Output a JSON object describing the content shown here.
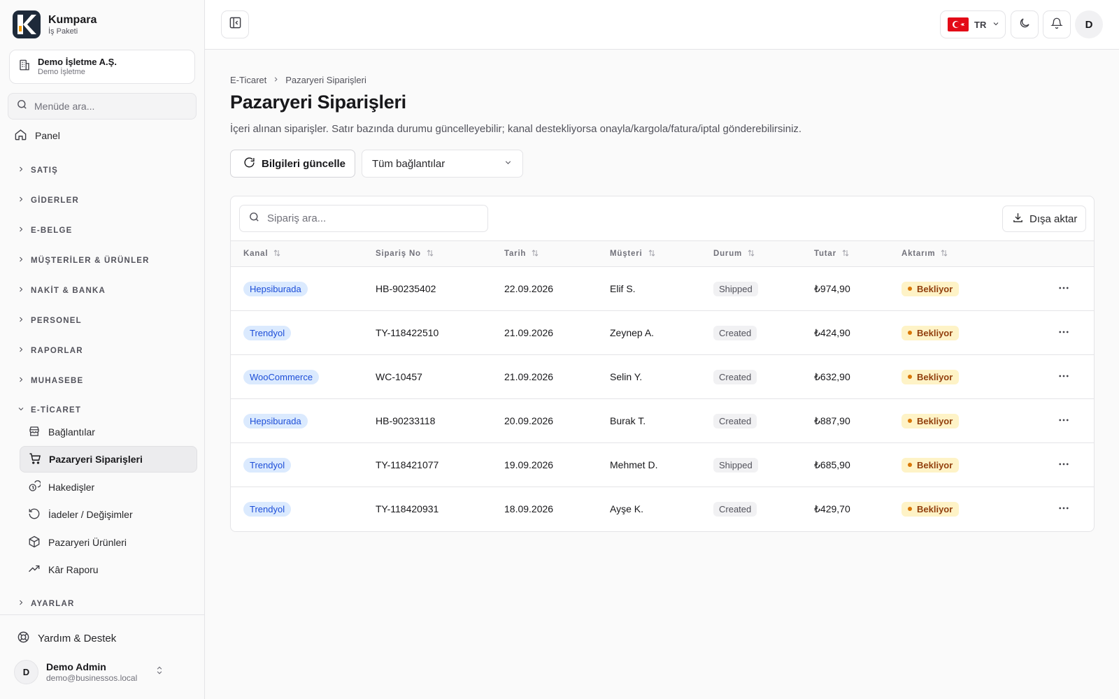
{
  "brand": {
    "name": "Kumpara",
    "sub": "İş Paketi"
  },
  "org": {
    "name": "Demo İşletme A.Ş.",
    "sub": "Demo İşletme"
  },
  "sidebar": {
    "search_placeholder": "Menüde ara...",
    "panel": "Panel",
    "sections": [
      "SATIŞ",
      "GİDERLER",
      "E-BELGE",
      "MÜŞTERİLER & ÜRÜNLER",
      "NAKİT & BANKA",
      "PERSONEL",
      "RAPORLAR",
      "MUHASEBE",
      "E-TİCARET",
      "AYARLAR"
    ],
    "ecommerce_items": [
      "Bağlantılar",
      "Pazaryeri Siparişleri",
      "Hakedişler",
      "İadeler / Değişimler",
      "Pazaryeri Ürünleri",
      "Kâr Raporu"
    ],
    "help": "Yardım & Destek",
    "user": {
      "initial": "D",
      "name": "Demo Admin",
      "email": "demo@businessos.local"
    }
  },
  "header": {
    "lang": "TR",
    "avatar_initial": "D"
  },
  "breadcrumb": [
    "E-Ticaret",
    "Pazaryeri Siparişleri"
  ],
  "page": {
    "title": "Pazaryeri Siparişleri",
    "description": "İçeri alınan siparişler. Satır bazında durumu güncelleyebilir; kanal destekliyorsa onayla/kargola/fatura/iptal gönderebilirsiniz.",
    "refresh_label": "Bilgileri güncelle",
    "connection_select": "Tüm bağlantılar"
  },
  "table": {
    "search_placeholder": "Sipariş ara...",
    "export_label": "Dışa aktar",
    "columns": [
      "Kanal",
      "Sipariş No",
      "Tarih",
      "Müşteri",
      "Durum",
      "Tutar",
      "Aktarım"
    ],
    "rows": [
      {
        "channel": "Hepsiburada",
        "order_no": "HB-90235402",
        "date": "22.09.2026",
        "customer": "Elif S.",
        "status": "Shipped",
        "amount": "₺974,90",
        "transfer": "Bekliyor"
      },
      {
        "channel": "Trendyol",
        "order_no": "TY-118422510",
        "date": "21.09.2026",
        "customer": "Zeynep A.",
        "status": "Created",
        "amount": "₺424,90",
        "transfer": "Bekliyor"
      },
      {
        "channel": "WooCommerce",
        "order_no": "WC-10457",
        "date": "21.09.2026",
        "customer": "Selin Y.",
        "status": "Created",
        "amount": "₺632,90",
        "transfer": "Bekliyor"
      },
      {
        "channel": "Hepsiburada",
        "order_no": "HB-90233118",
        "date": "20.09.2026",
        "customer": "Burak T.",
        "status": "Created",
        "amount": "₺887,90",
        "transfer": "Bekliyor"
      },
      {
        "channel": "Trendyol",
        "order_no": "TY-118421077",
        "date": "19.09.2026",
        "customer": "Mehmet D.",
        "status": "Shipped",
        "amount": "₺685,90",
        "transfer": "Bekliyor"
      },
      {
        "channel": "Trendyol",
        "order_no": "TY-118420931",
        "date": "18.09.2026",
        "customer": "Ayşe K.",
        "status": "Created",
        "amount": "₺429,70",
        "transfer": "Bekliyor"
      }
    ]
  },
  "colors": {
    "channel_badge": "#dbeafe",
    "pending_badge": "#fef3c7",
    "active_nav": "#ececee"
  }
}
